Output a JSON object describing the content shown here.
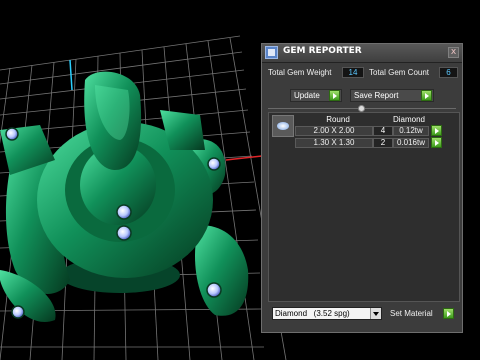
{
  "panel": {
    "title": "GEM REPORTER",
    "close_glyph": "x",
    "icon": "gem-reporter-app-icon"
  },
  "stats": {
    "total_weight_label": "Total Gem Weight",
    "total_weight_value": "14",
    "total_count_label": "Total Gem Count",
    "total_count_value": "6"
  },
  "actions": {
    "update_label": "Update",
    "save_report_label": "Save Report"
  },
  "table": {
    "headers": [
      "Round",
      "Diamond"
    ],
    "rows": [
      {
        "size": "2.00 X 2.00",
        "qty": "4",
        "weight": "0.12tw"
      },
      {
        "size": "1.30 X 1.30",
        "qty": "2",
        "weight": "0.016tw"
      }
    ]
  },
  "material": {
    "selected": "Diamond   (3.52 spg)",
    "set_label": "Set Material"
  },
  "colors": {
    "panel_bg": "#3c3c3c",
    "value_text": "#5cc8ff",
    "go_button": "#4caf22",
    "model": "#0f7a4a",
    "grid": "#8a8a8a"
  }
}
